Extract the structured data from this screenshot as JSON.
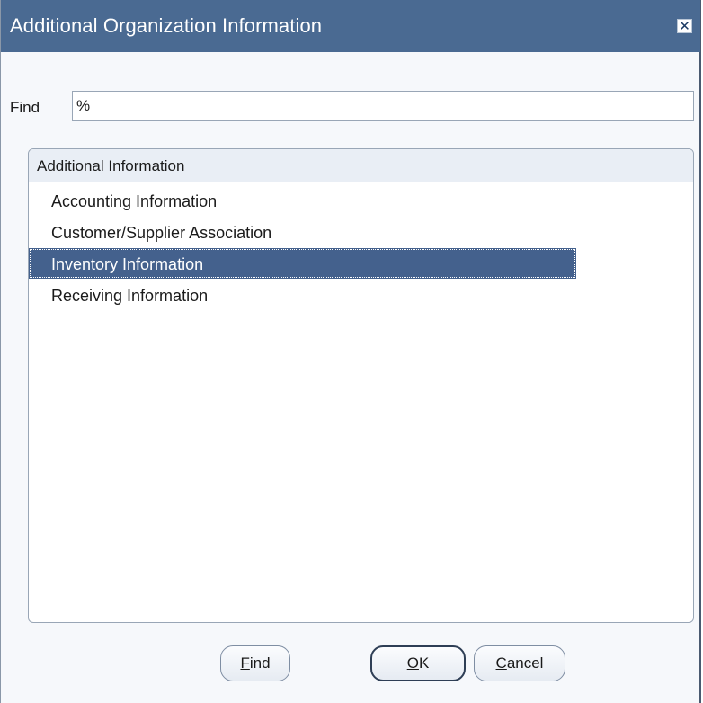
{
  "window": {
    "title": "Additional Organization Information",
    "close_glyph": "✕"
  },
  "find": {
    "label": "Find",
    "value": "%"
  },
  "list": {
    "column_header": "Additional Information",
    "items": [
      {
        "label": "Accounting Information",
        "selected": false
      },
      {
        "label": "Customer/Supplier Association",
        "selected": false
      },
      {
        "label": "Inventory Information",
        "selected": true
      },
      {
        "label": "Receiving Information",
        "selected": false
      }
    ]
  },
  "buttons": {
    "find": {
      "mnemonic": "F",
      "rest": "ind"
    },
    "ok": {
      "mnemonic": "O",
      "rest": "K"
    },
    "cancel": {
      "mnemonic": "C",
      "rest": "ancel"
    }
  },
  "colors": {
    "titlebar": "#4a6a92",
    "selection": "#44618d",
    "header": "#e9eef5"
  }
}
